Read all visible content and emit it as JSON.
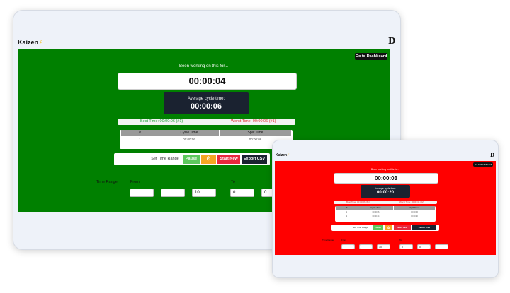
{
  "brand": {
    "name": "Kaizen",
    "mark": "D"
  },
  "app": {
    "dashboard_btn": "Go to Dashboard",
    "working_label": "Been working on this for...",
    "avg_label": "Average cycle time:",
    "table_headers": [
      "#",
      "Cycle Time",
      "Split Time"
    ],
    "controls": {
      "set_range": "Set Time Range",
      "pause": "Pause",
      "start_new": "Start New",
      "export": "Export CSV"
    },
    "range": {
      "label": "Time Range",
      "from": "From",
      "to": "To"
    }
  },
  "screens": [
    {
      "background": "#008000",
      "elapsed": "00:00:04",
      "avg_time": "00:00:06",
      "best": "Best Time: 00:00:06 (#1)",
      "worst": "Worst Time: 00:00:06 (#1)",
      "rows": [
        {
          "n": "1",
          "cycle": "00:00:06",
          "split": "00:00:06"
        }
      ],
      "range_values": {
        "from3": "10",
        "to1": "0",
        "to2": "0"
      }
    },
    {
      "background": "#ff0000",
      "elapsed": "00:00:03",
      "avg_time": "00:00:20",
      "best": "Best Time: 00:00:06 (#1)",
      "worst": "Worst Time: 00:00:34 (#2)",
      "rows": [
        {
          "n": "1",
          "cycle": "00:00:06",
          "split": "00:00:06"
        },
        {
          "n": "2",
          "cycle": "00:00:34",
          "split": "00:00:40"
        }
      ],
      "range_values": {
        "from3": "10",
        "to1": "0",
        "to2": "0"
      }
    }
  ],
  "colors": {
    "best": "#22a03a",
    "worst": "#e03030",
    "pause": "#5cc85c",
    "timer_icon": "#f5a623",
    "start_new": "#e8283c",
    "export": "#1a2230",
    "dashboard": "#111111"
  }
}
